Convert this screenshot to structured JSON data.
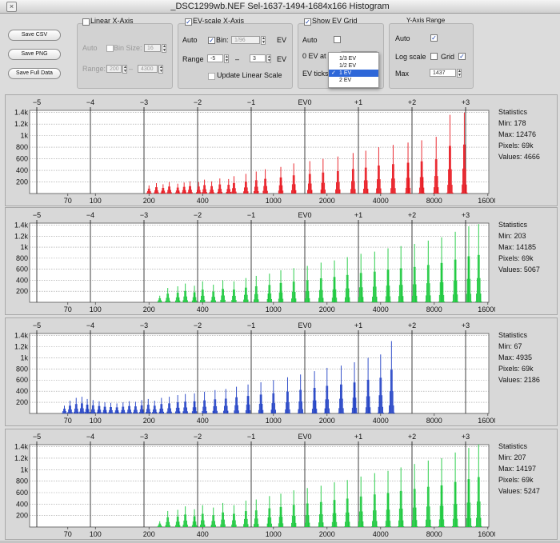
{
  "window": {
    "title": "_DSC1299wb.NEF Sel-1637-1494-1684x166 Histogram",
    "close_glyph": "×"
  },
  "buttons": {
    "save_csv": "Save CSV",
    "save_png": "Save PNG",
    "save_full": "Save Full Data"
  },
  "linear_axis": {
    "title": "Linear X-Axis",
    "checked": false,
    "auto_label": "Auto",
    "bin_size_label": "Bin Size:",
    "bin_size_value": "16",
    "range_label": "Range:",
    "range_min": "200",
    "range_dash": "–",
    "range_max": "4300"
  },
  "ev_axis": {
    "title": "EV-scale X-Axis",
    "checked": true,
    "auto_label": "Auto",
    "bin_label": "Bin:",
    "bin_checked": true,
    "bin_value": "1/96",
    "ev_unit": "EV",
    "range_label": "Range",
    "range_min": "-5",
    "range_dash": "–",
    "range_max": "3",
    "update_label": "Update Linear Scale"
  },
  "ev_grid": {
    "title": "Show EV Grid",
    "checked": true,
    "auto_label": "Auto",
    "zero_ev_label": "0 EV at",
    "ev_ticks_label": "EV ticks",
    "dropdown_options": [
      {
        "label": "1/3 EV",
        "selected": false
      },
      {
        "label": "1/2 EV",
        "selected": false
      },
      {
        "label": "1 EV",
        "selected": true
      },
      {
        "label": "2 EV",
        "selected": false
      }
    ],
    "check_glyph": "✓"
  },
  "y_axis": {
    "title": "Y-Axis Range",
    "auto_label": "Auto",
    "auto_checked": true,
    "log_label": "Log scale",
    "log_checked": false,
    "grid_label": "Grid",
    "grid_checked": true,
    "max_label": "Max",
    "max_value": "1437"
  },
  "axis": {
    "ev_ticks": [
      "−5",
      "−4",
      "−3",
      "−2",
      "−1",
      "EV0",
      "+1",
      "+2",
      "+3"
    ],
    "y_ticks": [
      "200",
      "400",
      "600",
      "800",
      "1k",
      "1.2k",
      "1.4k"
    ],
    "x_ticks": [
      "70",
      "100",
      "200",
      "400",
      "1000",
      "2000",
      "4000",
      "8000",
      "16000"
    ]
  },
  "colors": {
    "red": "#e8141c",
    "green": "#18c83a",
    "blue": "#1f3fc4",
    "plot_bg": "#ffffff",
    "grid": "#9a9a9a",
    "ev_line": "#111111"
  },
  "panels": [
    {
      "channel": "red",
      "color": "#e8141c",
      "stats_title": "Statistics",
      "min": "Min: 178",
      "max": "Max: 12476",
      "pixels": "Pixels: 69k",
      "values": "Values: 4666",
      "peaks": [
        [
          200,
          140
        ],
        [
          220,
          180
        ],
        [
          240,
          160
        ],
        [
          260,
          200
        ],
        [
          290,
          170
        ],
        [
          315,
          190
        ],
        [
          340,
          210
        ],
        [
          380,
          200
        ],
        [
          410,
          240
        ],
        [
          450,
          210
        ],
        [
          500,
          260
        ],
        [
          560,
          250
        ],
        [
          600,
          300
        ],
        [
          700,
          340
        ],
        [
          800,
          380
        ],
        [
          900,
          420
        ],
        [
          1100,
          460
        ],
        [
          1300,
          520
        ],
        [
          1600,
          560
        ],
        [
          1900,
          600
        ],
        [
          2300,
          640
        ],
        [
          2800,
          700
        ],
        [
          3300,
          740
        ],
        [
          3900,
          800
        ],
        [
          4700,
          840
        ],
        [
          5700,
          880
        ],
        [
          6800,
          920
        ],
        [
          8200,
          980
        ],
        [
          9800,
          1360
        ],
        [
          11800,
          1400
        ]
      ]
    },
    {
      "channel": "green",
      "color": "#18c83a",
      "stats_title": "Statistics",
      "min": "Min: 203",
      "max": "Max: 14185",
      "pixels": "Pixels: 69k",
      "values": "Values: 5067",
      "peaks": [
        [
          230,
          120
        ],
        [
          255,
          260
        ],
        [
          290,
          290
        ],
        [
          320,
          340
        ],
        [
          360,
          300
        ],
        [
          400,
          380
        ],
        [
          460,
          320
        ],
        [
          520,
          400
        ],
        [
          600,
          380
        ],
        [
          700,
          440
        ],
        [
          800,
          480
        ],
        [
          950,
          520
        ],
        [
          1100,
          580
        ],
        [
          1300,
          620
        ],
        [
          1550,
          660
        ],
        [
          1850,
          720
        ],
        [
          2200,
          760
        ],
        [
          2600,
          820
        ],
        [
          3100,
          880
        ],
        [
          3700,
          920
        ],
        [
          4400,
          980
        ],
        [
          5200,
          1020
        ],
        [
          6200,
          1060
        ],
        [
          7400,
          1120
        ],
        [
          8800,
          1180
        ],
        [
          10500,
          1280
        ],
        [
          12500,
          1380
        ],
        [
          14200,
          1420
        ]
      ]
    },
    {
      "channel": "blue",
      "color": "#1f3fc4",
      "stats_title": "Statistics",
      "min": "Min: 67",
      "max": "Max: 4935",
      "pixels": "Pixels: 69k",
      "values": "Values: 2186",
      "peaks": [
        [
          67,
          140
        ],
        [
          72,
          230
        ],
        [
          78,
          280
        ],
        [
          84,
          300
        ],
        [
          90,
          260
        ],
        [
          97,
          240
        ],
        [
          105,
          220
        ],
        [
          113,
          200
        ],
        [
          122,
          190
        ],
        [
          132,
          180
        ],
        [
          143,
          200
        ],
        [
          155,
          220
        ],
        [
          168,
          210
        ],
        [
          182,
          240
        ],
        [
          198,
          260
        ],
        [
          215,
          230
        ],
        [
          235,
          280
        ],
        [
          260,
          300
        ],
        [
          290,
          330
        ],
        [
          320,
          350
        ],
        [
          360,
          360
        ],
        [
          410,
          390
        ],
        [
          470,
          420
        ],
        [
          540,
          440
        ],
        [
          620,
          480
        ],
        [
          720,
          520
        ],
        [
          850,
          560
        ],
        [
          1000,
          600
        ],
        [
          1200,
          650
        ],
        [
          1420,
          700
        ],
        [
          1700,
          760
        ],
        [
          2000,
          820
        ],
        [
          2400,
          860
        ],
        [
          2850,
          920
        ],
        [
          3400,
          1000
        ],
        [
          4000,
          1060
        ],
        [
          4600,
          1300
        ]
      ]
    },
    {
      "channel": "green",
      "color": "#18c83a",
      "stats_title": "Statistics",
      "min": "Min: 207",
      "max": "Max: 14197",
      "pixels": "Pixels: 69k",
      "values": "Values: 5247",
      "peaks": [
        [
          230,
          100
        ],
        [
          255,
          280
        ],
        [
          290,
          300
        ],
        [
          320,
          360
        ],
        [
          360,
          310
        ],
        [
          400,
          380
        ],
        [
          460,
          340
        ],
        [
          520,
          420
        ],
        [
          600,
          380
        ],
        [
          700,
          460
        ],
        [
          800,
          480
        ],
        [
          950,
          540
        ],
        [
          1100,
          580
        ],
        [
          1300,
          640
        ],
        [
          1550,
          680
        ],
        [
          1850,
          720
        ],
        [
          2200,
          780
        ],
        [
          2600,
          820
        ],
        [
          3100,
          880
        ],
        [
          3700,
          940
        ],
        [
          4400,
          980
        ],
        [
          5200,
          1040
        ],
        [
          6200,
          1100
        ],
        [
          7400,
          1160
        ],
        [
          8800,
          1200
        ],
        [
          10500,
          1300
        ],
        [
          12500,
          1380
        ],
        [
          14200,
          1440
        ]
      ]
    }
  ]
}
